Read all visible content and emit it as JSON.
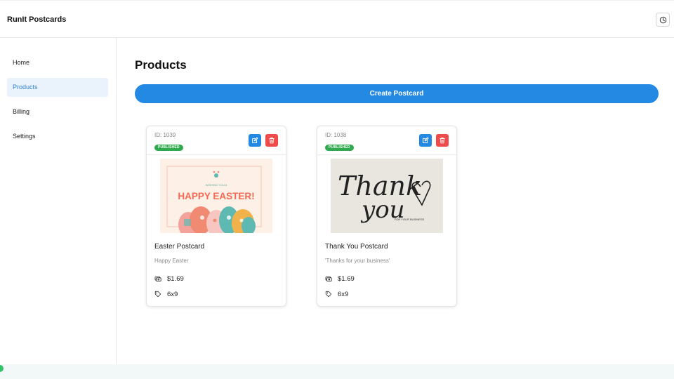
{
  "app": {
    "title": "RunIt Postcards"
  },
  "header": {
    "theme_icon": "clock-half-icon"
  },
  "sidebar": {
    "items": [
      {
        "label": "Home",
        "active": false
      },
      {
        "label": "Products",
        "active": true
      },
      {
        "label": "Billing",
        "active": false
      },
      {
        "label": "Settings",
        "active": false
      }
    ]
  },
  "main": {
    "title": "Products",
    "create_label": "Create Postcard"
  },
  "products": [
    {
      "id_label": "ID: 1039",
      "status": "PUBLISHED",
      "title": "Easter Postcard",
      "subtitle": "Happy Easter",
      "price": "$1.69",
      "size": "6x9",
      "image_text": {
        "small": "WISHING YOU A",
        "big": "HAPPY EASTER!"
      }
    },
    {
      "id_label": "ID: 1038",
      "status": "PUBLISHED",
      "title": "Thank You Postcard",
      "subtitle": "'Thanks for your business'",
      "price": "$1.69",
      "size": "6x9",
      "image_text": {
        "script1": "Thank",
        "script2": "you",
        "small": "FOR YOUR BUSINESS"
      }
    }
  ],
  "colors": {
    "accent": "#2389e3",
    "danger": "#ef4b4b",
    "success": "#2faa4f",
    "nav_active_bg": "#eaf2fc"
  }
}
